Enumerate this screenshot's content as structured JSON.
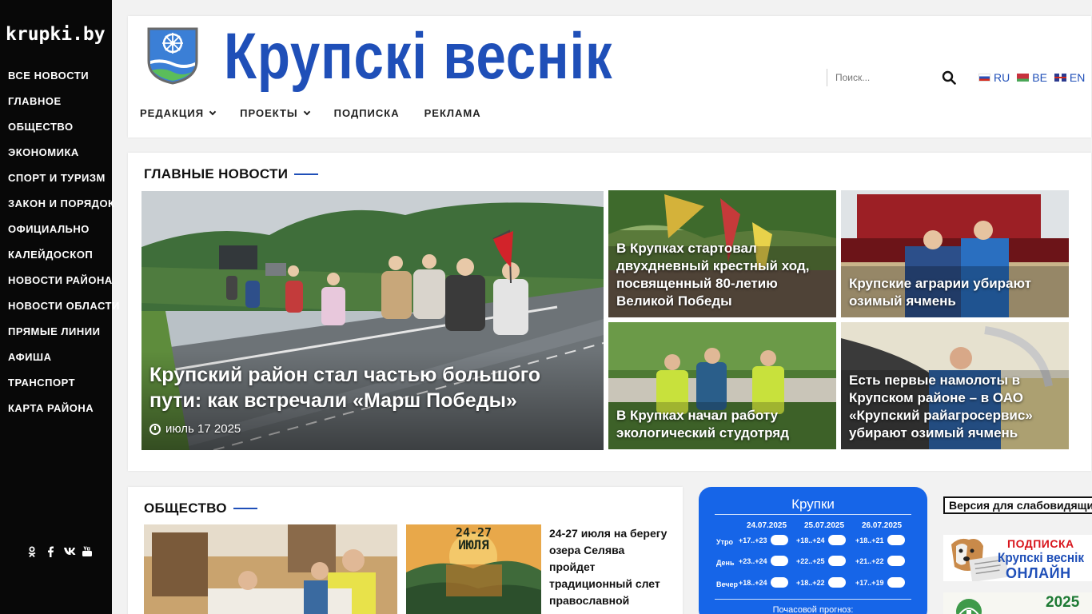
{
  "sidebar": {
    "logo": "krupki.by",
    "items": [
      {
        "label": "ВСЕ НОВОСТИ"
      },
      {
        "label": "ГЛАВНОЕ"
      },
      {
        "label": "ОБЩЕСТВО"
      },
      {
        "label": "ЭКОНОМИКА"
      },
      {
        "label": "СПОРТ И ТУРИЗМ"
      },
      {
        "label": "ЗАКОН И ПОРЯДОК"
      },
      {
        "label": "ОФИЦИАЛЬНО"
      },
      {
        "label": "КАЛЕЙДОСКОП"
      },
      {
        "label": "НОВОСТИ РАЙОНА"
      },
      {
        "label": "НОВОСТИ ОБЛАСТИ"
      },
      {
        "label": "ПРЯМЫЕ ЛИНИИ"
      },
      {
        "label": "АФИША"
      },
      {
        "label": "ТРАНСПОРТ"
      },
      {
        "label": "КАРТА РАЙОНА"
      }
    ],
    "social_icons": [
      "odnoklassniki-icon",
      "facebook-icon",
      "vk-icon",
      "youtube-icon"
    ]
  },
  "header": {
    "title": "Крупскі веснік",
    "search_placeholder": "Поиск...",
    "languages": [
      {
        "code": "RU"
      },
      {
        "code": "BE"
      },
      {
        "code": "EN"
      }
    ],
    "nav": [
      {
        "label": "РЕДАКЦИЯ",
        "has_dropdown": true
      },
      {
        "label": "ПРОЕКТЫ",
        "has_dropdown": true
      },
      {
        "label": "ПОДПИСКА",
        "has_dropdown": false
      },
      {
        "label": "РЕКЛАМА",
        "has_dropdown": false
      }
    ]
  },
  "main_news": {
    "section_title": "ГЛАВНЫЕ НОВОСТИ",
    "featured": {
      "title": "Крупский район стал частью большого пути: как встречали «Марш Победы»",
      "date": "июль 17 2025"
    },
    "tiles": [
      {
        "title": "В Крупках стартовал двухдневный крестный ход, посвященный 80-летию Великой Победы"
      },
      {
        "title": "Крупские аграрии убирают озимый ячмень"
      },
      {
        "title": "В Крупках начал работу экологический студотряд"
      },
      {
        "title": "Есть первые намолоты в Крупском районе – в ОАО «Крупский райагросервис» убирают озимый ячмень"
      }
    ]
  },
  "society": {
    "section_title": "ОБЩЕСТВО",
    "poster": {
      "line1": "24-27",
      "line2": "ИЮЛЯ"
    },
    "article_text": "24-27 июля на берегу озера Селява пройдет традиционный слет православной"
  },
  "weather": {
    "city": "Крупки",
    "dates": [
      "24.07.2025",
      "25.07.2025",
      "26.07.2025"
    ],
    "rows": [
      {
        "label": "Утро",
        "values": [
          "+17..+23",
          "+18..+24",
          "+18..+21"
        ]
      },
      {
        "label": "День",
        "values": [
          "+23..+24",
          "+22..+25",
          "+21..+22"
        ]
      },
      {
        "label": "Вечер",
        "values": [
          "+18..+24",
          "+18..+22",
          "+17..+19"
        ]
      }
    ],
    "footer": "Почасовой прогноз:"
  },
  "right_column": {
    "accessibility": "Версия для слабовидящих",
    "subscribe_banner": {
      "line1": "ПОДПИСКА",
      "line2": "Крупскі веснік",
      "line3": "ОНЛАЙН"
    },
    "year_banner": {
      "year": "2025"
    }
  },
  "colors": {
    "brand_blue": "#1f4fb8",
    "sidebar_bg": "#080808",
    "weather_bg": "#1665e8",
    "subscribe_red": "#d8141b"
  }
}
